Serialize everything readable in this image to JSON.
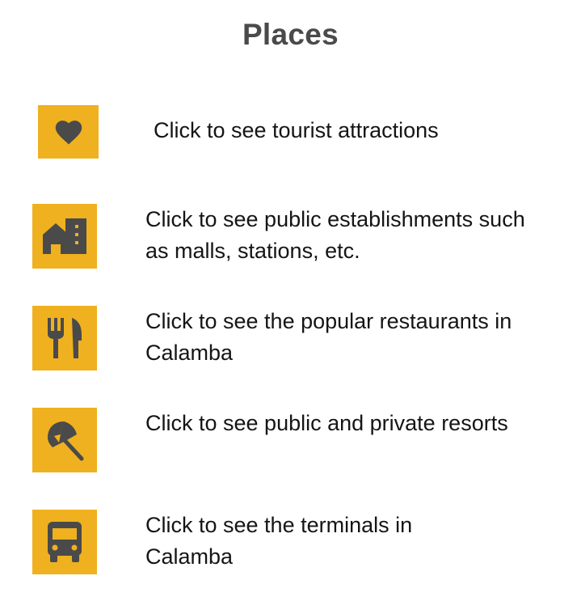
{
  "page": {
    "title": "Places"
  },
  "theme": {
    "icon_background": "#efb11f",
    "icon_color": "#4a4a4a"
  },
  "places": [
    {
      "icon": "heart-icon",
      "label": "Click to see tourist attractions"
    },
    {
      "icon": "building-icon",
      "label": "Click to see public establishments such as malls, stations, etc."
    },
    {
      "icon": "restaurant-icon",
      "label": "Click to see the popular restaurants in Calamba"
    },
    {
      "icon": "beach-umbrella-icon",
      "label": "Click to see public and private resorts"
    },
    {
      "icon": "bus-icon",
      "label": "Click to see the terminals in Calamba"
    }
  ]
}
